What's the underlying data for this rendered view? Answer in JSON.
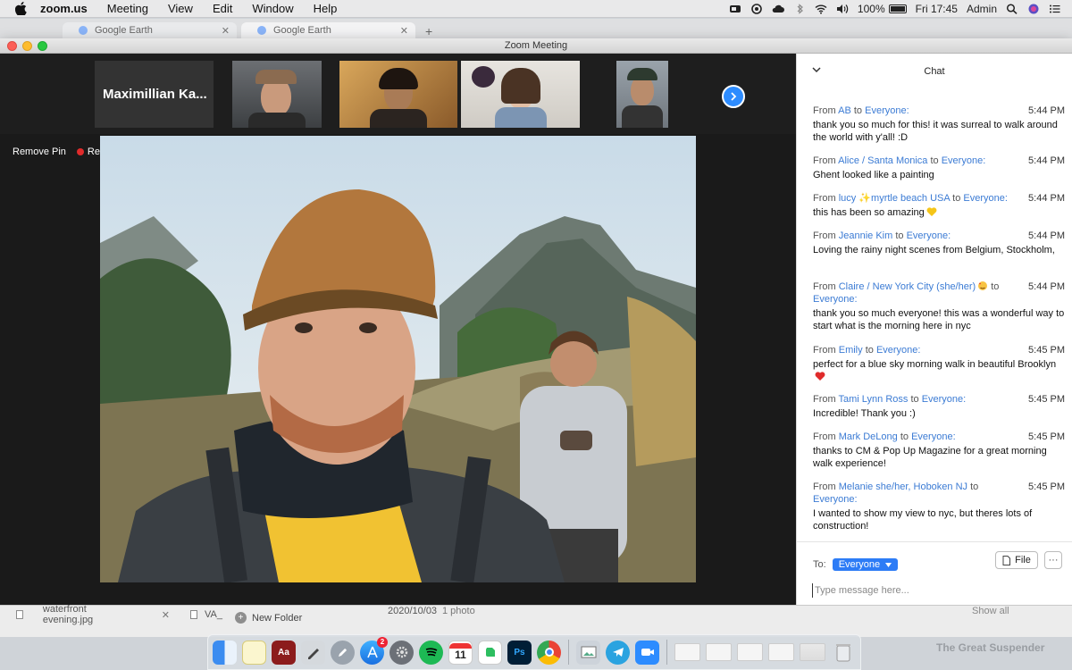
{
  "menubar": {
    "app": "zoom.us",
    "items": [
      "Meeting",
      "View",
      "Edit",
      "Window",
      "Help"
    ],
    "battery": "100%",
    "clock": "Fri 17:45",
    "user": "Admin"
  },
  "browser_tabs": [
    "Google Earth",
    "Google Earth"
  ],
  "window": {
    "title": "Zoom Meeting"
  },
  "thumbnails": {
    "name_tile": "Maximillian Ka..."
  },
  "video_controls": {
    "remove_pin": "Remove Pin",
    "recording": "Recording"
  },
  "chat": {
    "title": "Chat",
    "messages": [
      {
        "from": "AB",
        "to": "Everyone:",
        "time": "5:44 PM",
        "text": "thank you so much for this! it was surreal to walk around the world with y'all! :D"
      },
      {
        "from": "Alice / Santa Monica",
        "to": "Everyone:",
        "time": "5:44 PM",
        "text": "Ghent looked like a painting"
      },
      {
        "from": "lucy ✨myrtle beach USA",
        "to": "Everyone:",
        "time": "5:44 PM",
        "text": "this has been so amazing"
      },
      {
        "from": "Jeannie Kim",
        "to": "Everyone:",
        "time": "5:44 PM",
        "text": "Loving the rainy night scenes from Belgium, Stockholm,"
      },
      {
        "from": "Claire / New York City (she/her)",
        "to": "Everyone:",
        "time": "5:44 PM",
        "text": "thank you so much everyone! this was a wonderful way to start what is the morning here in nyc"
      },
      {
        "from": "Emily",
        "to": "Everyone:",
        "time": "5:45 PM",
        "text": "perfect for a blue sky morning walk in beautiful Brooklyn"
      },
      {
        "from": "Tami Lynn Ross",
        "to": "Everyone:",
        "time": "5:45 PM",
        "text": "Incredible! Thank you :)"
      },
      {
        "from": "Mark DeLong",
        "to": "Everyone:",
        "time": "5:45 PM",
        "text": "thanks to CM & Pop Up Magazine for a great morning walk experience!"
      },
      {
        "from": "Melanie she/her, Hoboken NJ",
        "to": "Everyone:",
        "time": "5:45 PM",
        "text": "I wanted to show my view to nyc, but theres lots of construction!"
      }
    ],
    "from_word": "From",
    "to_word": "to",
    "to_label": "To:",
    "recipient": "Everyone",
    "file_label": "File",
    "more_label": "···",
    "input_placeholder": "Type message here..."
  },
  "finder": {
    "tab1": "waterfront evening.jpg",
    "tab2": "VA_",
    "new_folder": "New Folder",
    "date": "2020/10/03",
    "photo_count": "1 photo",
    "show_all": "Show all"
  },
  "dock": {
    "appstore_badge": "2",
    "calendar_day": "11",
    "ps_label": "Ps",
    "dict_label": "Aa"
  },
  "suspender": "The Great Suspender",
  "colors": {
    "zoom_blue": "#2d8cff",
    "link_blue": "#3b7bd4",
    "record_red": "#e02b2b"
  }
}
